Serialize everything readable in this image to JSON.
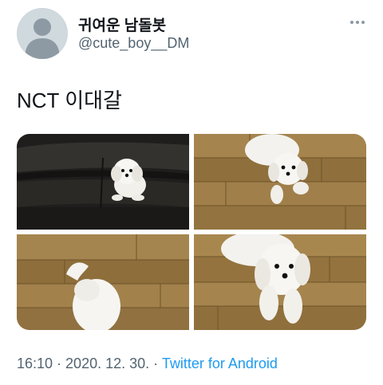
{
  "tweet": {
    "author": {
      "display_name": "귀여운 남돌봇",
      "handle": "@cute_boy__DM",
      "avatar_icon": "default-avatar-icon"
    },
    "more_icon": "more-options-icon",
    "text": "NCT 이대갈",
    "media": [
      {
        "subject": "white puppy sitting on black leather sofa"
      },
      {
        "subject": "white puppy lying on wooden floor"
      },
      {
        "subject": "white puppy tail on wooden floor"
      },
      {
        "subject": "white puppy close-up on wooden floor"
      }
    ],
    "meta": {
      "time": "16:10",
      "separator": " · ",
      "date": "2020. 12. 30.",
      "source": "Twitter for Android"
    }
  },
  "colors": {
    "text_primary": "#0f1419",
    "text_secondary": "#536471",
    "link": "#1d9bf0",
    "avatar_bg": "#cfd9de",
    "avatar_fg": "#8e9aa3"
  }
}
